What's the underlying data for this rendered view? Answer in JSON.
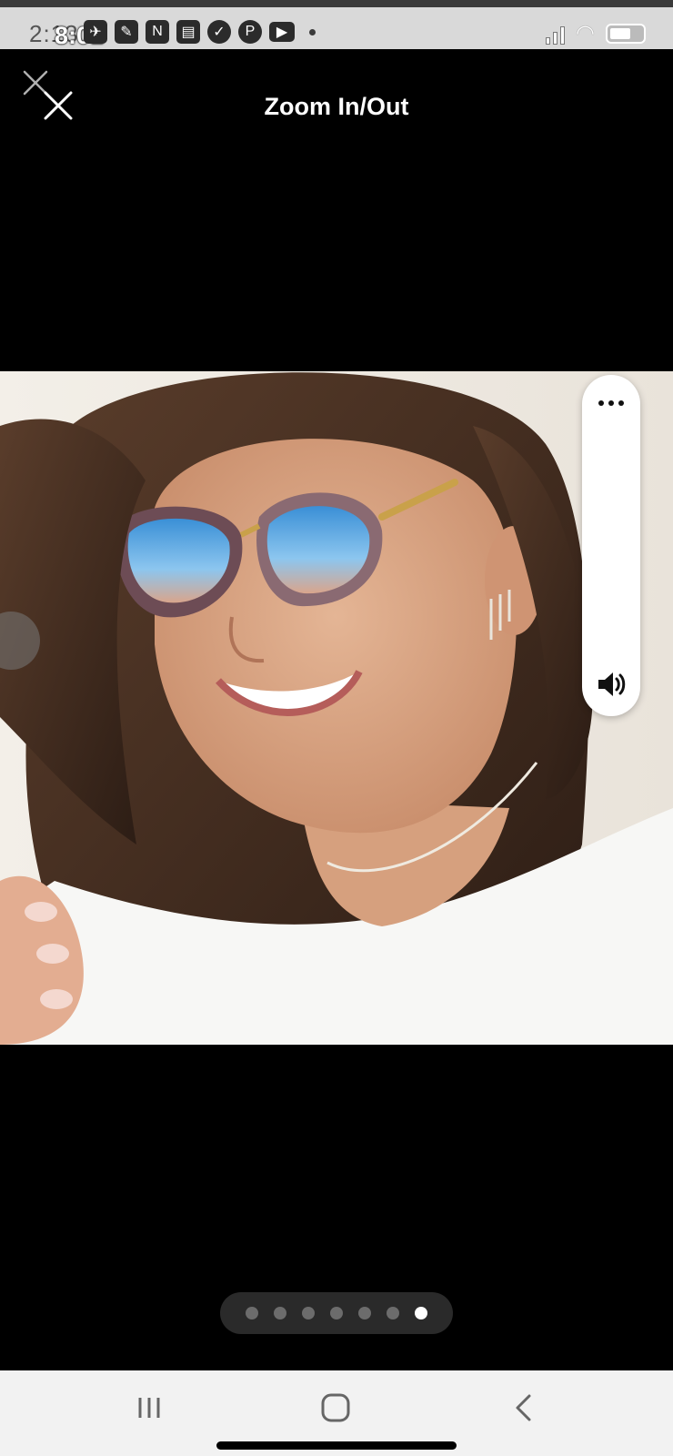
{
  "status_bar": {
    "time": "8:01",
    "time_underlay": "2:13",
    "notification_icons": [
      "app-icon",
      "app-icon",
      "app-icon",
      "news-icon",
      "check-icon",
      "pinterest-icon",
      "youtube-icon"
    ]
  },
  "header": {
    "title": "Zoom In/Out"
  },
  "side_panel": {
    "more_icon": "more-dots-icon",
    "volume_icon": "volume-icon"
  },
  "pagination": {
    "total": 7,
    "active_index": 6
  },
  "nav_bar": {
    "buttons": [
      "recent-apps",
      "home",
      "back"
    ]
  },
  "colors": {
    "background": "#000000",
    "status_bar": "#d9d9d9",
    "nav_bar": "#f2f2f2",
    "pager_active": "#ffffff",
    "pager_inactive": "#6c6c6c"
  }
}
